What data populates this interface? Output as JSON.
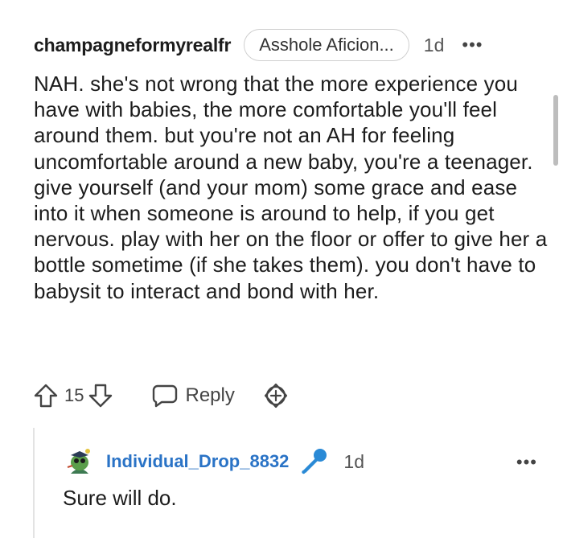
{
  "comment": {
    "username": "champagneformyrealfr",
    "flair": "Asshole Aficion...",
    "age": "1d",
    "more": "•••",
    "body": "NAH. she's not wrong that the more experience you have with babies, the more comfortable you'll feel around them. but you're not an AH for feeling uncomfortable around a new baby, you're a teenager. give yourself (and your mom) some grace and ease into it when someone is around to help, if you get nervous. play with her on the floor or offer to give her a bottle sometime (if she takes them). you don't have to babysit to interact and bond with her.",
    "votes": "15",
    "reply_label": "Reply"
  },
  "reply": {
    "username": "Individual_Drop_8832",
    "age": "1d",
    "more": "•••",
    "body": "Sure will do."
  },
  "colors": {
    "username_link": "#2a73c6",
    "mic_badge": "#2a8ad6"
  }
}
